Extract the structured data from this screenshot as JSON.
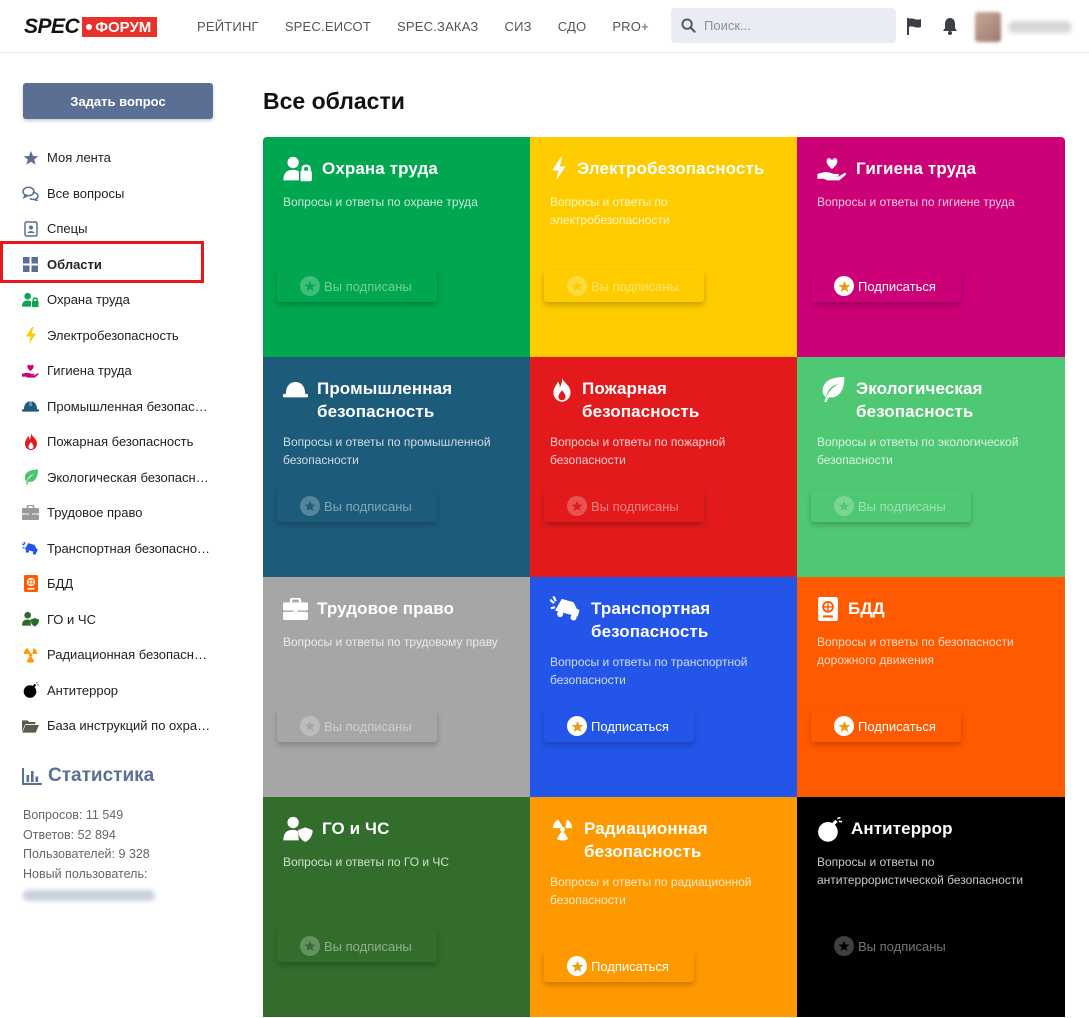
{
  "header": {
    "logo_spec": "SPEC",
    "logo_forum": "ФОРУМ",
    "nav": [
      "РЕЙТИНГ",
      "SPEC.ЕИСОТ",
      "SPEC.ЗАКАЗ",
      "СИЗ",
      "СДО",
      "PRO+"
    ],
    "search_placeholder": "Поиск..."
  },
  "sidebar": {
    "ask_button": "Задать вопрос",
    "items": [
      {
        "label": "Моя лента",
        "icon": "star-icon",
        "color": "#5b6f95"
      },
      {
        "label": "Все вопросы",
        "icon": "chat-icon",
        "color": "#5b6f95"
      },
      {
        "label": "Спецы",
        "icon": "id-card-icon",
        "color": "#5b6f95"
      },
      {
        "label": "Области",
        "icon": "grid-icon",
        "color": "#5b6f95",
        "active": true
      },
      {
        "label": "Охрана труда",
        "icon": "user-lock-icon",
        "color": "#0aa550"
      },
      {
        "label": "Электробезопасность",
        "icon": "bolt-icon",
        "color": "#ffcc00"
      },
      {
        "label": "Гигиена труда",
        "icon": "hand-heart-icon",
        "color": "#cc0077"
      },
      {
        "label": "Промышленная безопасность",
        "icon": "hard-hat-icon",
        "color": "#1e5b7e"
      },
      {
        "label": "Пожарная безопасность",
        "icon": "fire-icon",
        "color": "#e21b1b"
      },
      {
        "label": "Экологическая безопасность",
        "icon": "leaf-icon",
        "color": "#4cc66e"
      },
      {
        "label": "Трудовое право",
        "icon": "briefcase-icon",
        "color": "#9a9a9a"
      },
      {
        "label": "Транспортная безопасность",
        "icon": "car-crash-icon",
        "color": "#2256e6"
      },
      {
        "label": "БДД",
        "icon": "passport-icon",
        "color": "#ff5c00"
      },
      {
        "label": "ГО и ЧС",
        "icon": "user-shield-icon",
        "color": "#2e6b2b"
      },
      {
        "label": "Радиационная безопасность",
        "icon": "radiation-icon",
        "color": "#ff9900"
      },
      {
        "label": "Антитеррор",
        "icon": "bomb-icon",
        "color": "#000000"
      },
      {
        "label": "База инструкций по охране труда",
        "icon": "folder-open-icon",
        "color": "#5b5b4d"
      }
    ]
  },
  "stats": {
    "title": "Статистика",
    "questions": "Вопросов: 11 549",
    "answers": "Ответов: 52 894",
    "users": "Пользователей: 9 328",
    "new_user": "Новый пользователь:"
  },
  "main": {
    "title": "Все области",
    "subscribed_label": "Вы подписаны",
    "subscribe_label": "Подписаться",
    "cards": [
      {
        "title": "Охрана труда",
        "desc": "Вопросы и ответы по охране труда",
        "color": "#00a650",
        "icon": "user-lock-icon",
        "subscribed": true
      },
      {
        "title": "Электробезопасность",
        "desc": "Вопросы и ответы по электробезопасности",
        "color": "#ffcc00",
        "icon": "bolt-icon",
        "subscribed": true
      },
      {
        "title": "Гигиена труда",
        "desc": "Вопросы и ответы по гигиене труда",
        "color": "#cc0077",
        "icon": "hand-heart-icon",
        "subscribed": false
      },
      {
        "title": "Промышленная безопасность",
        "desc": "Вопросы и ответы по промышленной безопасности",
        "color": "#1d5b7b",
        "icon": "hard-hat-icon",
        "subscribed": true
      },
      {
        "title": "Пожарная безопасность",
        "desc": "Вопросы и ответы по пожарной безопасности",
        "color": "#e21a1c",
        "icon": "fire-icon",
        "subscribed": true
      },
      {
        "title": "Экологическая безопасность",
        "desc": "Вопросы и ответы по экологической безопасности",
        "color": "#4fc873",
        "icon": "leaf-icon",
        "subscribed": true
      },
      {
        "title": "Трудовое право",
        "desc": "Вопросы и ответы по трудовому праву",
        "color": "#a6a6a6",
        "icon": "briefcase-icon",
        "subscribed": true
      },
      {
        "title": "Транспортная безопасность",
        "desc": "Вопросы и ответы по транспортной безопасности",
        "color": "#2255e8",
        "icon": "car-crash-icon",
        "subscribed": false
      },
      {
        "title": "БДД",
        "desc": "Вопросы и ответы по безопасности дорожного движения",
        "color": "#ff5a00",
        "icon": "passport-icon",
        "subscribed": false
      },
      {
        "title": "ГО и ЧС",
        "desc": "Вопросы и ответы по ГО и ЧС",
        "color": "#326d2c",
        "icon": "user-shield-icon",
        "subscribed": true
      },
      {
        "title": "Радиационная безопасность",
        "desc": "Вопросы и ответы по радиационной безопасности",
        "color": "#ff9900",
        "icon": "radiation-icon",
        "subscribed": false
      },
      {
        "title": "Антитеррор",
        "desc": "Вопросы и ответы по антитеррористической безопасности",
        "color": "#000000",
        "icon": "bomb-icon",
        "subscribed": true
      }
    ]
  }
}
